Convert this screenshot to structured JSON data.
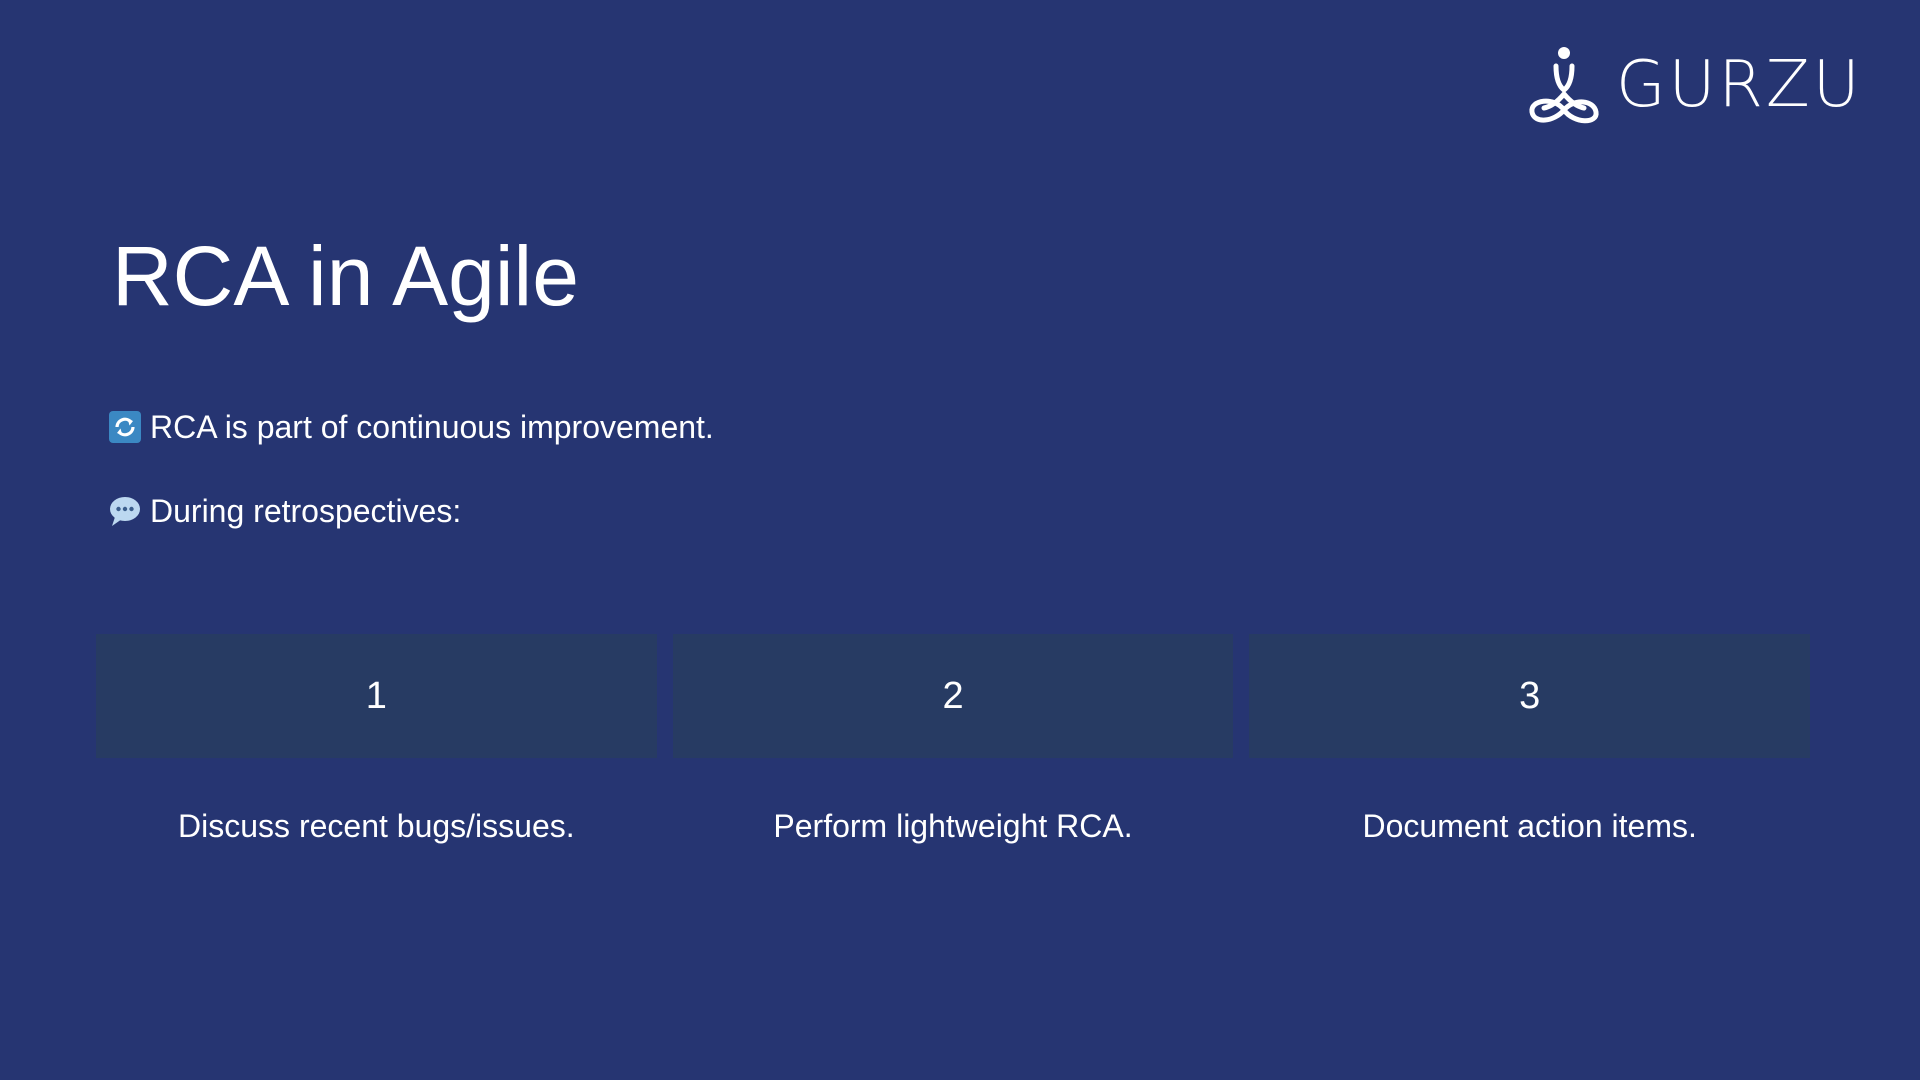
{
  "brand": {
    "name": "GURZU",
    "logo_icon": "meditating-figure-infinity-icon"
  },
  "slide": {
    "title": "RCA in Agile",
    "bullets": [
      {
        "icon": "refresh-arrows-icon",
        "text": "RCA is part of continuous improvement."
      },
      {
        "icon": "speech-bubble-icon",
        "text": "During retrospectives:"
      }
    ],
    "steps": [
      {
        "number": "1",
        "label": "Discuss recent bugs/issues."
      },
      {
        "number": "2",
        "label": "Perform lightweight RCA."
      },
      {
        "number": "3",
        "label": "Document action items."
      }
    ]
  },
  "colors": {
    "background": "#263572",
    "step_box": "#273b63",
    "text": "#ffffff",
    "refresh_icon": "#3b88c3",
    "speech_icon": "#bcd8f0"
  }
}
